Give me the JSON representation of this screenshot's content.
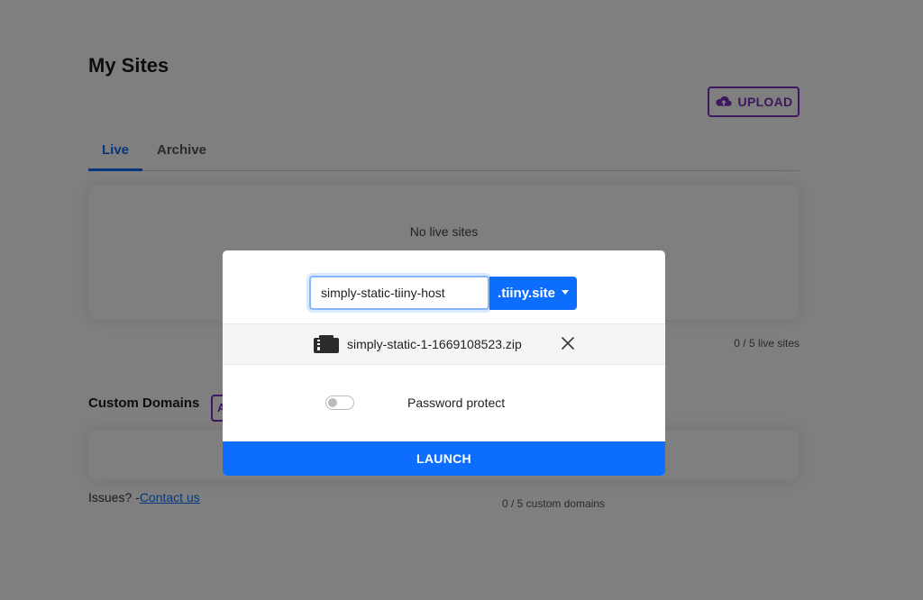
{
  "page": {
    "title": "My Sites",
    "upload_label": "UPLOAD",
    "tabs": [
      {
        "label": "Live",
        "active": true
      },
      {
        "label": "Archive",
        "active": false
      }
    ],
    "no_sites_text": "No live sites",
    "live_count": "0 / 5 live sites",
    "custom_domains_title": "Custom Domains",
    "custom_domains_add_label": "A",
    "custom_domains_count": "0 / 5 custom domains",
    "issues_prefix": "Issues? -",
    "contact_link": "Contact us"
  },
  "modal": {
    "subdomain_value": "simply-static-tiiny-host",
    "domain_suffix": ".tiiny.site",
    "file_name": "simply-static-1-1669108523.zip",
    "password_label": "Password protect",
    "password_enabled": false,
    "launch_label": "LAUNCH"
  },
  "colors": {
    "primary": "#0d6efd",
    "accent_purple": "#7b2fbf",
    "overlay": "rgba(0,0,0,0.5)"
  }
}
